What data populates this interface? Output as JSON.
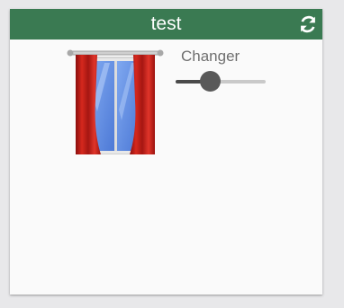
{
  "card": {
    "title": "test",
    "header_color": "#3a7a52",
    "refresh_icon": "refresh-icon"
  },
  "content": {
    "image_icon": "window-with-curtains-icon",
    "slider": {
      "label": "Changer",
      "value_fraction": 0.38
    }
  }
}
